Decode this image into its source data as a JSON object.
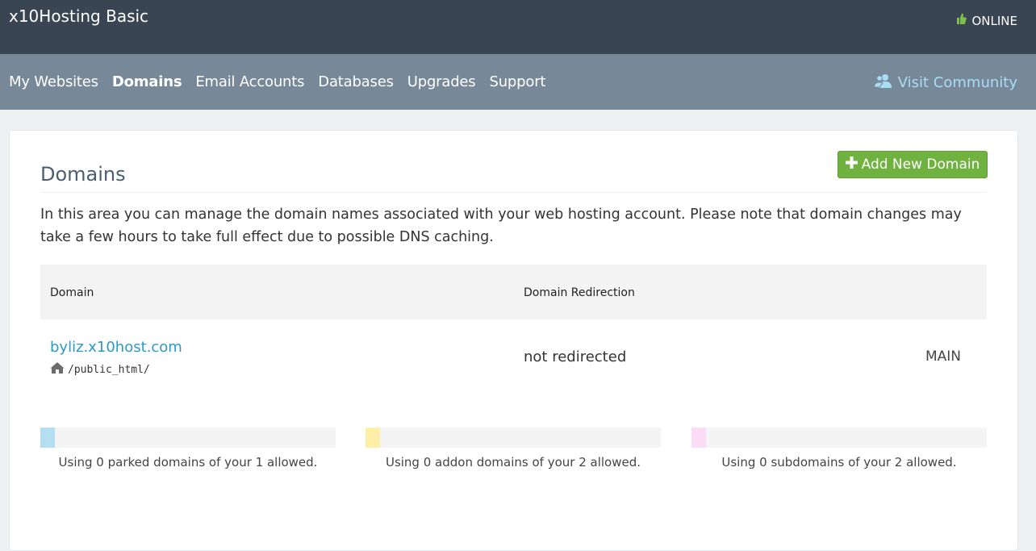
{
  "header": {
    "brand": "x10Hosting Basic",
    "status_text": "ONLINE",
    "status_icon": "thumbs-up-icon",
    "status_color": "#7fbf4d"
  },
  "nav": {
    "items": [
      {
        "label": "My Websites",
        "active": false
      },
      {
        "label": "Domains",
        "active": true
      },
      {
        "label": "Email Accounts",
        "active": false
      },
      {
        "label": "Databases",
        "active": false
      },
      {
        "label": "Upgrades",
        "active": false
      },
      {
        "label": "Support",
        "active": false
      }
    ],
    "community_label": "Visit Community",
    "community_icon": "users-icon",
    "community_color": "#a9ddf4"
  },
  "page": {
    "title": "Domains",
    "add_button_label": "Add New Domain",
    "add_button_icon": "plus-icon",
    "add_button_color": "#6fb23f",
    "description": "In this area you can manage the domain names associated with your web hosting account. Please note that domain changes may take a few hours to take full effect due to possible DNS caching."
  },
  "table": {
    "headers": [
      "Domain",
      "Domain Redirection"
    ],
    "rows": [
      {
        "domain": "byliz.x10host.com",
        "docroot": "/public_html/",
        "docroot_icon": "home-icon",
        "redirection": "not redirected",
        "type": "MAIN"
      }
    ]
  },
  "usage": [
    {
      "text": "Using 0 parked domains of your 1 allowed.",
      "used": 0,
      "allowed": 1,
      "color": "#b3dff0"
    },
    {
      "text": "Using 0 addon domains of your 2 allowed.",
      "used": 0,
      "allowed": 2,
      "color": "#fdf0a6"
    },
    {
      "text": "Using 0 subdomains of your 2 allowed.",
      "used": 0,
      "allowed": 2,
      "color": "#fbdcf7"
    }
  ]
}
